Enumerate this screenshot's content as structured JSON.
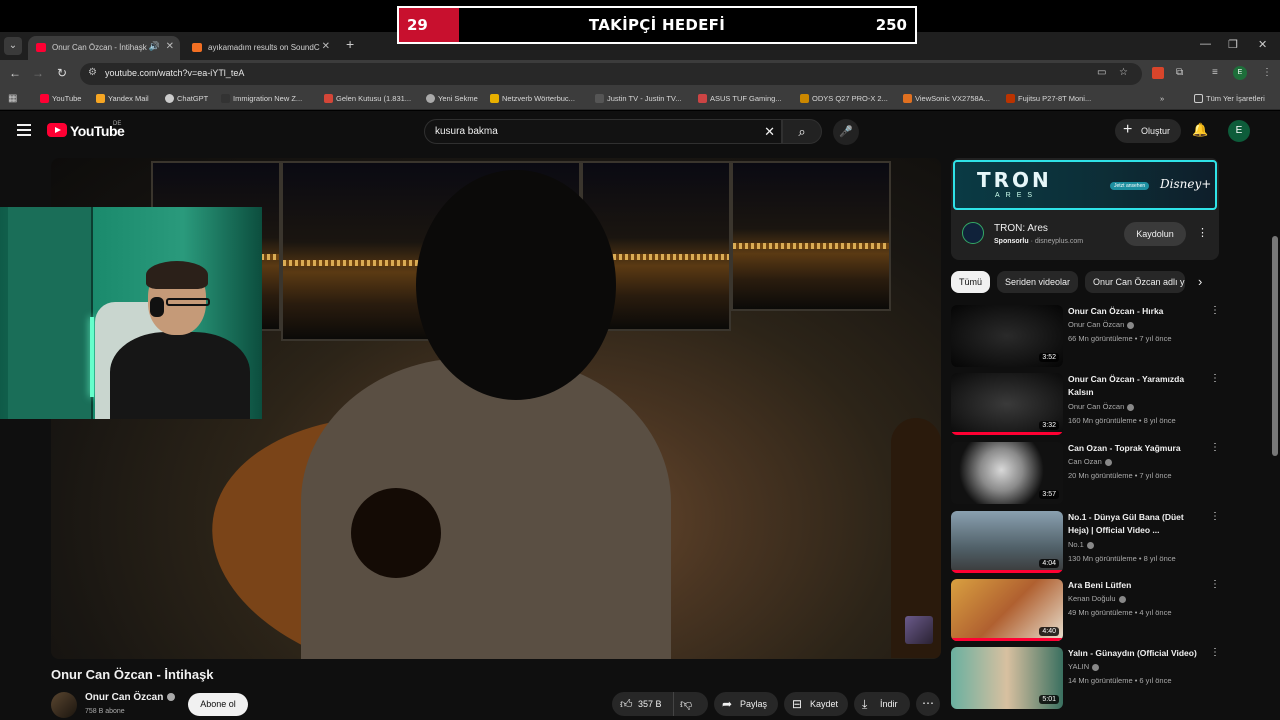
{
  "overlay": {
    "goal_current": "29",
    "goal_title": "TAKİPÇİ HEDEFİ",
    "goal_target": "250",
    "goal_progress_fraction": 0.116,
    "goal_color": "#c8102e"
  },
  "browser": {
    "tabs": [
      {
        "title": "Onur Can Özcan - İntihaşk",
        "active": true
      },
      {
        "title": "ayıkamadım results on SoundC",
        "active": false
      }
    ],
    "url": "youtube.com/watch?v=ea-iYTl_teA",
    "bookmarks": [
      "YouTube",
      "Yandex Mail",
      "ChatGPT",
      "Immigration New Z...",
      "Gelen Kutusu (1.831...",
      "Yeni Sekme",
      "Netzverb Wörterbuc...",
      "Justin TV - Justin TV...",
      "ASUS TUF Gaming...",
      "ODYS Q27 PRO-X 2...",
      "ViewSonic VX2758A...",
      "Fujitsu P27-8T Moni..."
    ],
    "all_bookmarks": "Tüm Yer İşaretleri",
    "profile_initial": "E"
  },
  "youtube": {
    "logo": "YouTube",
    "region": "DE",
    "search_query": "kusura bakma",
    "create_label": "Oluştur",
    "avatar_initial": "E",
    "video": {
      "title": "Onur Can Özcan - İntihaşk",
      "channel": "Onur Can Özcan",
      "subscribers": "758 B abone",
      "subscribe_label": "Abone ol",
      "likes": "357 B",
      "share_label": "Paylaş",
      "save_label": "Kaydet",
      "download_label": "İndir"
    },
    "ad": {
      "banner_logo": "TRON",
      "banner_sub": "ARES",
      "banner_pill": "Jetzt ansehen",
      "banner_brand": "Disney+",
      "title": "TRON: Ares",
      "sponsored": "Sponsorlu",
      "domain": "disneyplus.com",
      "cta": "Kaydolun"
    },
    "chips": [
      "Tümü",
      "Seriden videolar",
      "Onur Can Özcan adlı y"
    ],
    "recommendations": [
      {
        "title": "Onur Can Özcan - Hırka",
        "channel": "Onur Can Özcan",
        "meta": "66 Mn görüntüleme • 7 yıl önce",
        "duration": "3:52",
        "watched": 0.0
      },
      {
        "title": "Onur Can Özcan - Yaramızda Kalsın",
        "channel": "Onur Can Özcan",
        "meta": "160 Mn görüntüleme • 8 yıl önce",
        "duration": "3:32",
        "watched": 1.0
      },
      {
        "title": "Can Ozan - Toprak Yağmura",
        "channel": "Can Ozan",
        "meta": "20 Mn görüntüleme • 7 yıl önce",
        "duration": "3:57",
        "watched": 0.0
      },
      {
        "title": "No.1 - Dünya Gül Bana (Düet Heja) | Official Video ...",
        "channel": "No.1",
        "meta": "130 Mn görüntüleme • 8 yıl önce",
        "duration": "4:04",
        "watched": 1.0
      },
      {
        "title": "Ara Beni Lütfen",
        "channel": "Kenan Doğulu",
        "meta": "49 Mn görüntüleme • 4 yıl önce",
        "duration": "4:40",
        "watched": 1.0
      },
      {
        "title": "Yalın - Günaydın (Official Video)",
        "channel": "YALIN",
        "meta": "14 Mn görüntüleme • 6 yıl önce",
        "duration": "5:01",
        "watched": 0.0
      }
    ]
  }
}
